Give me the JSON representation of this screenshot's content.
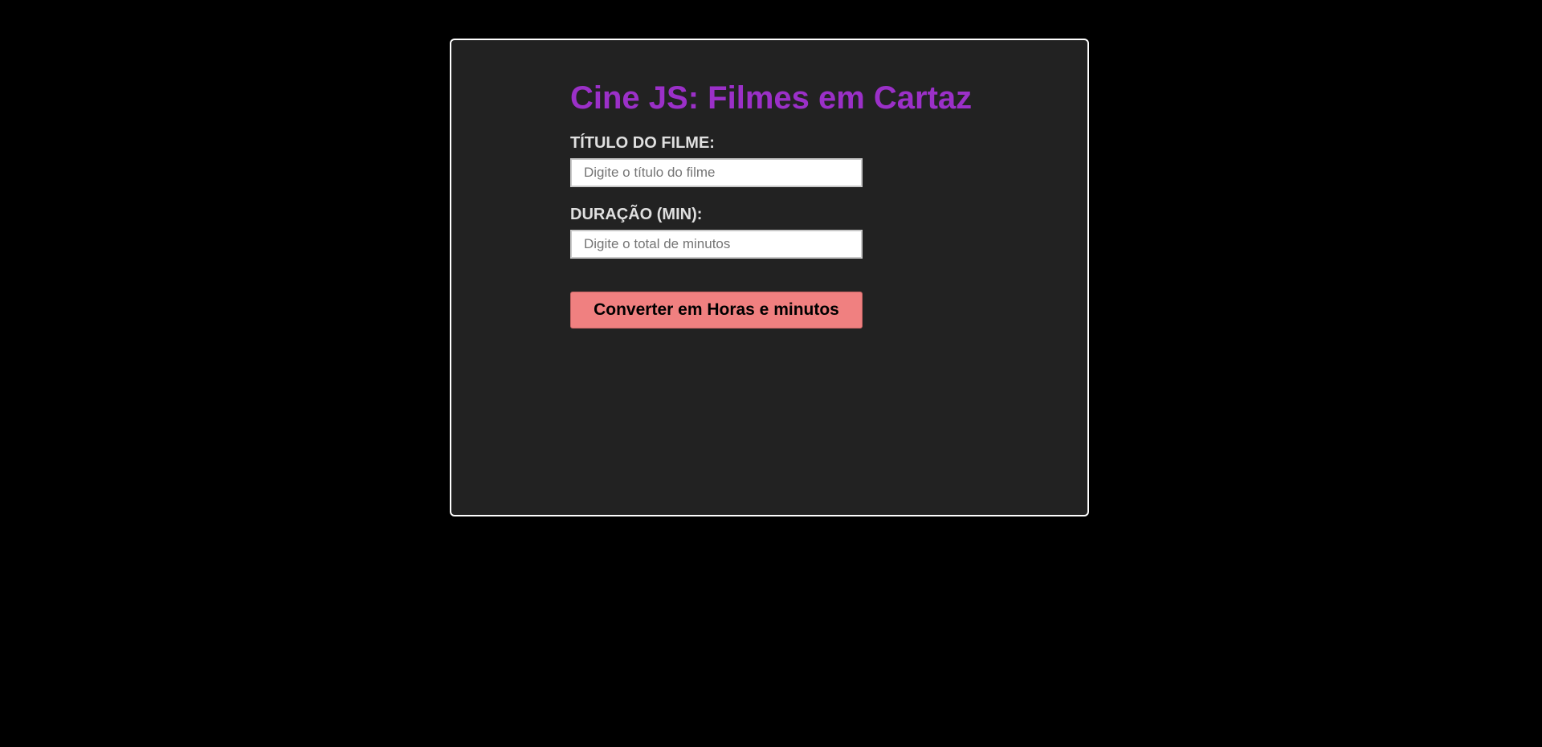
{
  "app": {
    "title": "Cine JS: Filmes em Cartaz"
  },
  "form": {
    "title_label": "TÍTULO DO FILME:",
    "title_value": "",
    "title_placeholder": "Digite o título do filme",
    "duration_label": "DURAÇÃO (MIN):",
    "duration_value": "",
    "duration_placeholder": "Digite o total de minutos",
    "convert_button_label": "Converter em Horas e minutos"
  },
  "colors": {
    "background": "#000000",
    "panel": "#222222",
    "panel_border": "#ffffff",
    "title": "#9b30c8",
    "label": "#e0e0e0",
    "button": "#f08080"
  }
}
